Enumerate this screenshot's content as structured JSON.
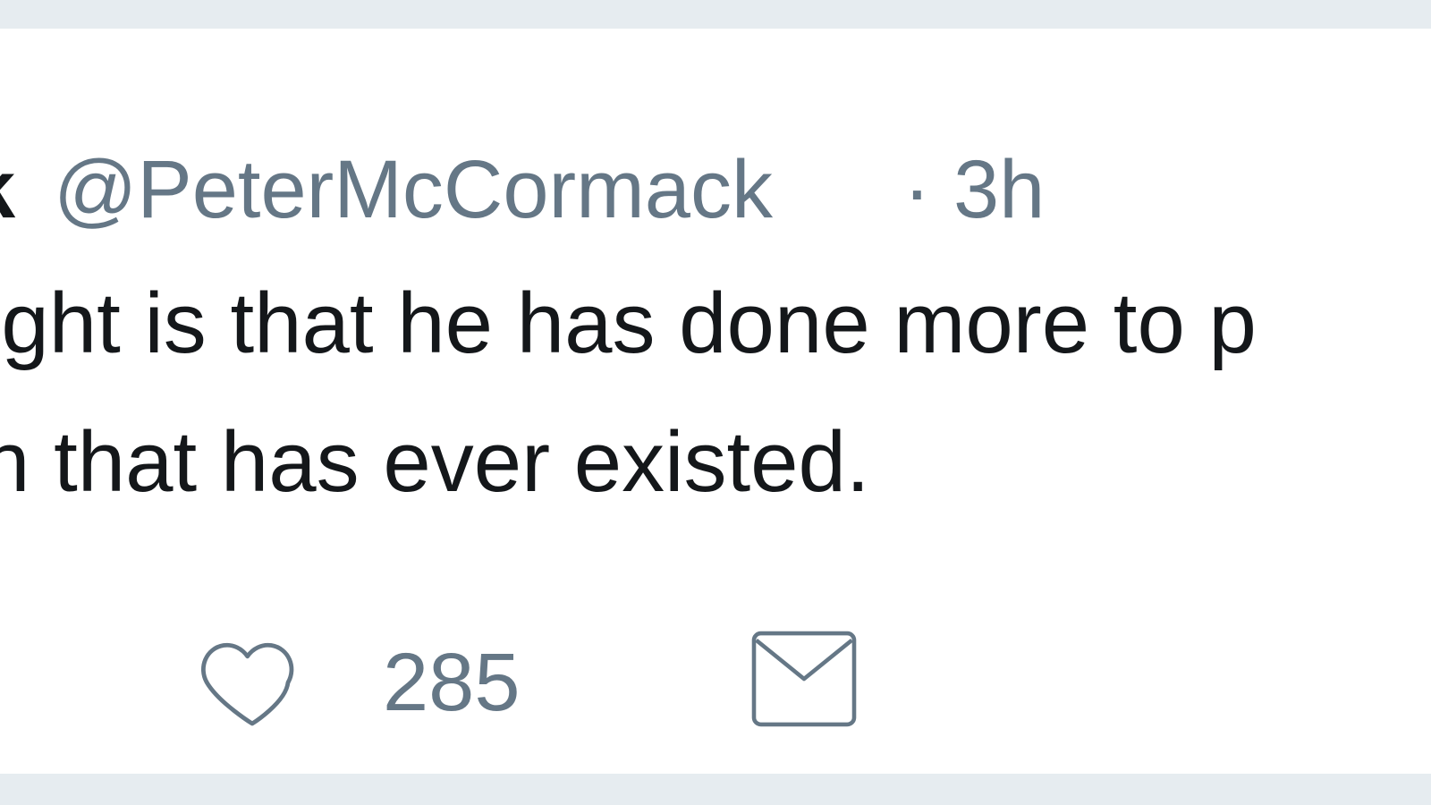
{
  "tweet": {
    "author_name_fragment": "k",
    "handle": "@PeterMcCormack",
    "separator": "·",
    "time": "3h",
    "text_line1": "ight is that he has done more to p",
    "text_line2": "n that has ever existed."
  },
  "actions": {
    "like_icon": "heart-outline-icon",
    "like_count": "285",
    "message_icon": "envelope-icon"
  },
  "colors": {
    "text_primary": "#14171a",
    "text_secondary": "#657786",
    "background": "#e6ecf0",
    "card": "#ffffff"
  }
}
